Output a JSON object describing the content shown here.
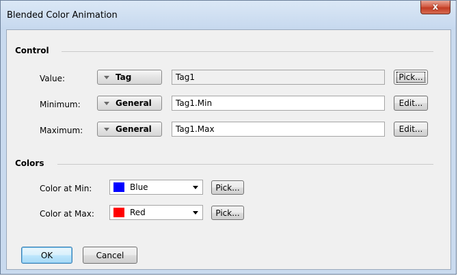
{
  "window": {
    "title": "Blended Color Animation",
    "close_glyph": "x"
  },
  "control": {
    "heading": "Control",
    "rows": [
      {
        "label": "Value:",
        "type_label": "Tag",
        "field_value": "Tag1",
        "button_label": "Pick..."
      },
      {
        "label": "Minimum:",
        "type_label": "General",
        "field_value": "Tag1.Min",
        "button_label": "Edit..."
      },
      {
        "label": "Maximum:",
        "type_label": "General",
        "field_value": "Tag1.Max",
        "button_label": "Edit..."
      }
    ]
  },
  "colors": {
    "heading": "Colors",
    "rows": [
      {
        "label": "Color at Min:",
        "color_name": "Blue",
        "swatch": "#0000ff",
        "button_label": "Pick..."
      },
      {
        "label": "Color at Max:",
        "color_name": "Red",
        "swatch": "#ff0000",
        "button_label": "Pick..."
      }
    ]
  },
  "footer": {
    "ok_label": "OK",
    "cancel_label": "Cancel"
  }
}
